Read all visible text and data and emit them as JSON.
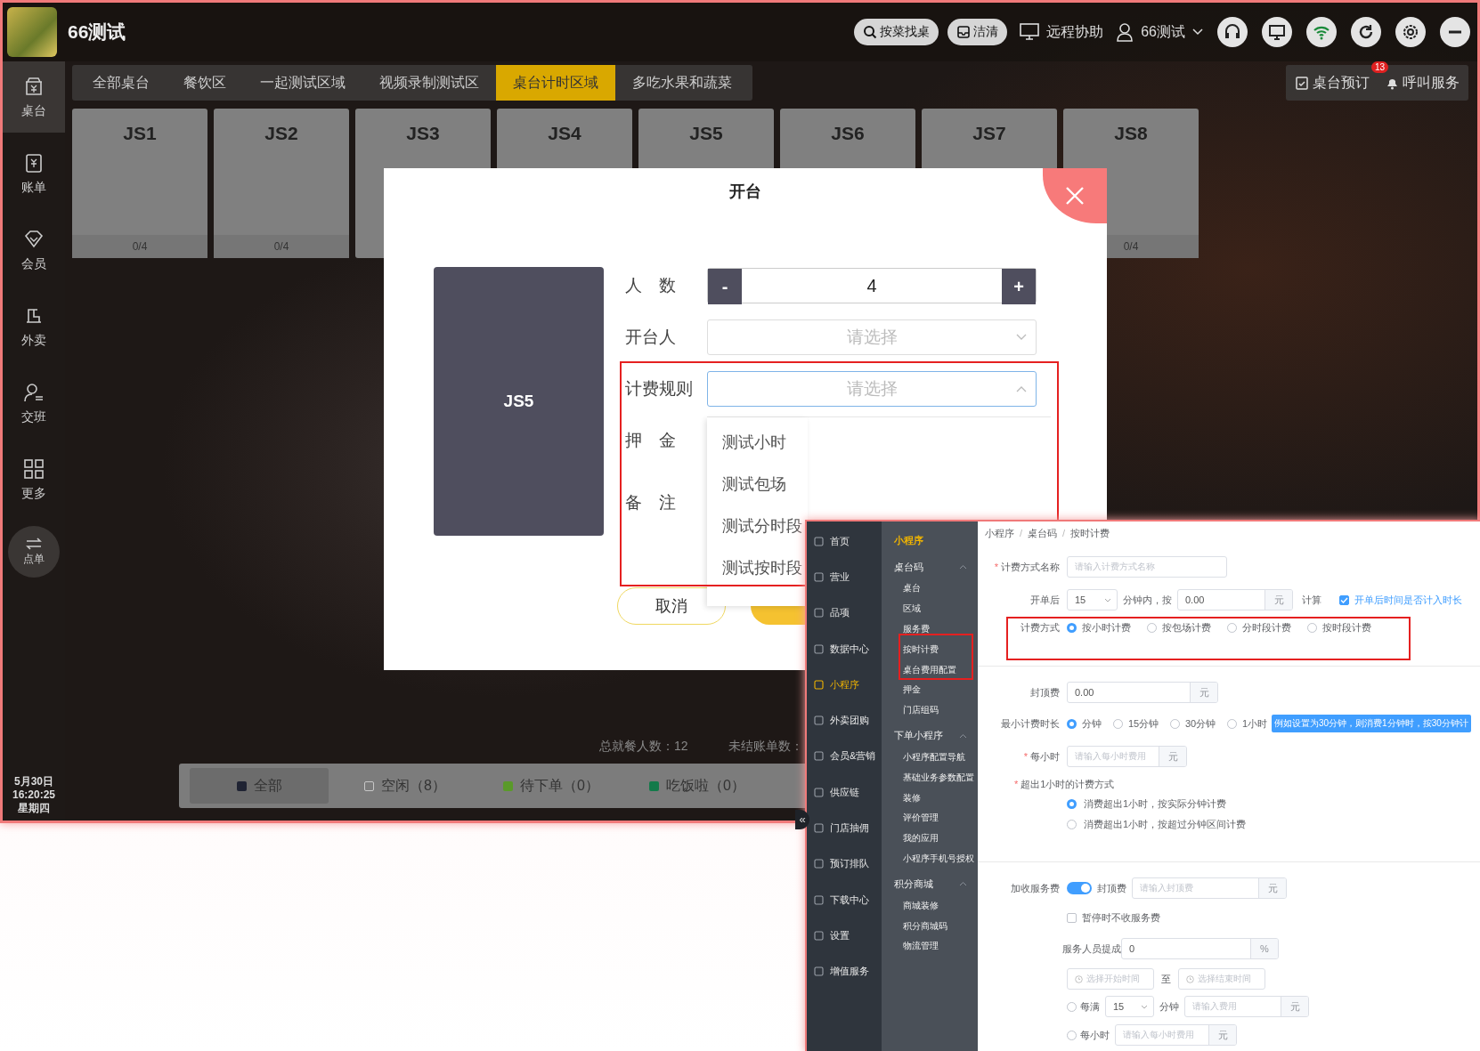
{
  "app": {
    "title": "66测试",
    "toolbar": [
      {
        "kind": "search",
        "label": "按菜找桌"
      },
      {
        "kind": "clean",
        "label": "洁清"
      },
      {
        "kind": "remote",
        "label": "远程协助"
      },
      {
        "kind": "user",
        "label": "66测试"
      }
    ],
    "sidebar": [
      {
        "label": "桌台",
        "selected": true
      },
      {
        "label": "账单",
        "selected": false
      },
      {
        "label": "会员",
        "selected": false
      },
      {
        "label": "外卖",
        "selected": false
      },
      {
        "label": "交班",
        "selected": false
      },
      {
        "label": "更多",
        "selected": false
      }
    ],
    "order_button": "点单",
    "date": {
      "date": "5月30日",
      "time": "16:20:25",
      "weekday": "星期四"
    },
    "tabs": [
      {
        "label": "全部桌台",
        "selected": false
      },
      {
        "label": "餐饮区",
        "selected": false
      },
      {
        "label": "一起测试区域",
        "selected": false
      },
      {
        "label": "视频录制测试区",
        "selected": false
      },
      {
        "label": "桌台计时区域",
        "selected": true
      },
      {
        "label": "多吃水果和蔬菜",
        "selected": false
      }
    ],
    "tab_actions": [
      {
        "kind": "reserve",
        "label": "桌台预订",
        "badge": "13"
      },
      {
        "kind": "bell",
        "label": "呼叫服务"
      }
    ],
    "tables": [
      {
        "name": "JS1",
        "seats": "0/4"
      },
      {
        "name": "JS2",
        "seats": "0/4"
      },
      {
        "name": "JS3"
      },
      {
        "name": "JS4"
      },
      {
        "name": "JS5"
      },
      {
        "name": "JS6"
      },
      {
        "name": "JS7"
      },
      {
        "name": "JS8",
        "seats": "0/4"
      }
    ],
    "stats": [
      "总就餐人数：12",
      "未结账单数："
    ],
    "filters": [
      {
        "label": "全部",
        "selected": true,
        "color": "#1f2333"
      },
      {
        "label": "空闲（8）",
        "selected": false,
        "color": "#c8c8c8"
      },
      {
        "label": "待下单（0）",
        "selected": false,
        "color": "#5a9a2a"
      },
      {
        "label": "吃饭啦（0）",
        "selected": false,
        "color": "#137a4a"
      }
    ]
  },
  "dialog": {
    "title": "开台",
    "table": "JS5",
    "fields": [
      {
        "kind": "stepper",
        "label": "人 数",
        "value": "4",
        "minus": "-",
        "plus": "+"
      },
      {
        "kind": "select",
        "label": "开台人",
        "placeholder": "请选择",
        "expanded": false
      },
      {
        "kind": "select",
        "label": "计费规则",
        "placeholder": "请选择",
        "expanded": true,
        "options": [
          "测试小时",
          "测试包场",
          "测试分时段",
          "测试按时段"
        ]
      },
      {
        "kind": "text",
        "label": "押 金"
      },
      {
        "kind": "text",
        "label": "备 注"
      }
    ],
    "buttons": [
      {
        "kind": "cancel",
        "label": "取消"
      },
      {
        "kind": "confirm"
      }
    ]
  },
  "admin": {
    "nav": [
      {
        "label": "首页",
        "selected": false
      },
      {
        "label": "营业",
        "selected": false
      },
      {
        "label": "品项",
        "selected": false
      },
      {
        "label": "数据中心",
        "selected": false
      },
      {
        "label": "小程序",
        "selected": true
      },
      {
        "label": "外卖团购",
        "selected": false
      },
      {
        "label": "会员&营销",
        "selected": false
      },
      {
        "label": "供应链",
        "selected": false
      },
      {
        "label": "门店抽佣",
        "selected": false
      },
      {
        "label": "预订排队",
        "selected": false
      },
      {
        "label": "下载中心",
        "selected": false
      },
      {
        "label": "设置",
        "selected": false
      },
      {
        "label": "增值服务",
        "selected": false
      }
    ],
    "collapse": "«",
    "subnav_title": "小程序",
    "groups": [
      {
        "label": "桌台码",
        "expanded": true,
        "children": [
          "桌台",
          "区域",
          "服务费",
          "按时计费",
          "桌台费用配置",
          "押金",
          "门店组码"
        ]
      },
      {
        "label": "下单小程序",
        "expanded": true,
        "children": [
          "小程序配置导航",
          "基础业务参数配置",
          "装修",
          "评价管理",
          "我的应用",
          "小程序手机号授权"
        ]
      },
      {
        "label": "积分商城",
        "expanded": true,
        "children": [
          "商城装修",
          "积分商城码",
          "物流管理"
        ]
      }
    ],
    "breadcrumb": {
      "items": [
        "小程序",
        "桌台码",
        "按时计费"
      ],
      "separator": "/"
    },
    "form": {
      "name": {
        "mark": "*",
        "label": "计费方式名称",
        "placeholder": "请输入计费方式名称"
      },
      "start": {
        "label": "开单后",
        "minutes": "15",
        "text_1": "分钟内，按",
        "amount": "0.00",
        "unit": "元",
        "text_2": "计算",
        "check_label": "开单后时间是否计入时长",
        "checked": true
      },
      "mode": {
        "label": "计费方式",
        "options": [
          {
            "label": "按小时计费",
            "selected": true
          },
          {
            "label": "按包场计费",
            "selected": false
          },
          {
            "label": "分时段计费",
            "selected": false
          },
          {
            "label": "按时段计费",
            "selected": false
          }
        ]
      },
      "cap": {
        "label": "封顶费",
        "value": "0.00",
        "unit": "元"
      },
      "min_duration": {
        "label": "最小计费时长",
        "options": [
          {
            "label": "分钟",
            "selected": true
          },
          {
            "label": "15分钟",
            "selected": false
          },
          {
            "label": "30分钟",
            "selected": false
          },
          {
            "label": "1小时",
            "selected": false
          }
        ],
        "tip": "例如设置为30分钟，则消费1分钟时，按30分钟计"
      },
      "hourly": {
        "mark": "*",
        "label": "每小时",
        "placeholder": "请输入每小时费用",
        "unit": "元"
      },
      "overtime": {
        "mark": "*",
        "label": "超出1小时的计费方式",
        "options": [
          {
            "label": "消费超出1小时，按实际分钟计费",
            "selected": true
          },
          {
            "label": "消费超出1小时，按超过分钟区间计费",
            "selected": false
          }
        ]
      },
      "service": {
        "label": "加收服务费",
        "on": true,
        "cap_label": "封顶费",
        "cap_placeholder": "请输入封顶费",
        "unit": "元"
      },
      "pause": {
        "label": "暂停时不收服务费",
        "checked": false
      },
      "commission": {
        "label": "服务人员提成",
        "value": "0",
        "unit": "%"
      },
      "time_range": {
        "start_placeholder": "选择开始时间",
        "separator": "至",
        "end_placeholder": "选择结束时间"
      },
      "per_block": {
        "selected": false,
        "label": "每满",
        "minutes": "15",
        "unit_label": "分钟",
        "placeholder": "请输入费用",
        "unit": "元"
      },
      "per_hour": {
        "selected": false,
        "label": "每小时",
        "placeholder": "请输入每小时费用",
        "unit": "元"
      }
    }
  }
}
